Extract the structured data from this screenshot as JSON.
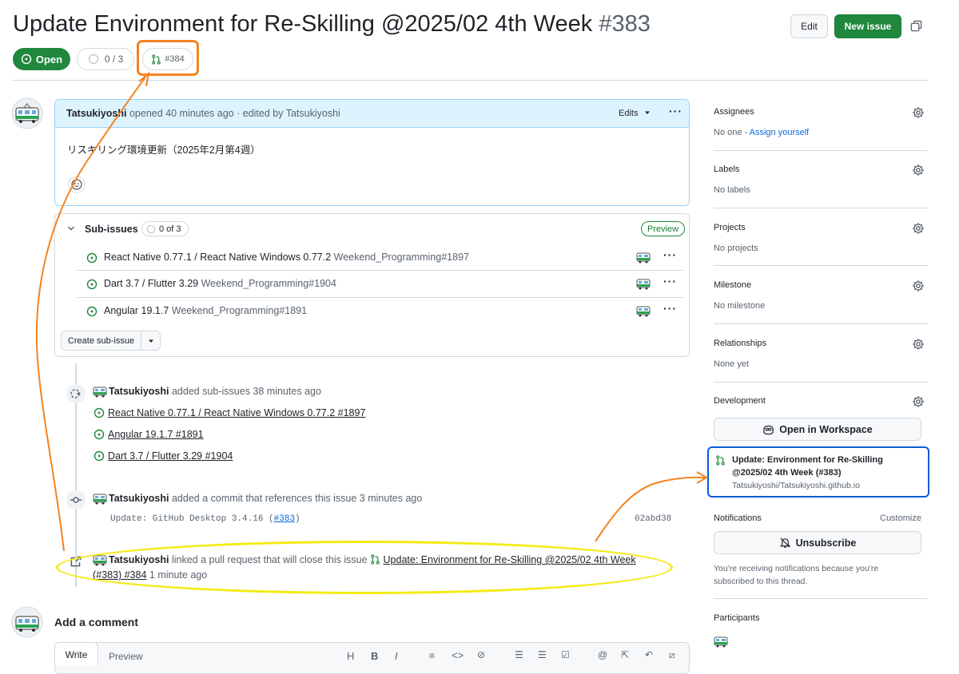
{
  "issue": {
    "title": "Update Environment for Re-Skilling @2025/02 4th Week",
    "number": "#383",
    "state": "Open",
    "subissue_progress": "0 / 3",
    "linked_pr": "#384"
  },
  "header_buttons": {
    "edit": "Edit",
    "new_issue": "New issue"
  },
  "description": {
    "author": "Tatsukiyoshi",
    "meta": "opened 40 minutes ago · edited by Tatsukiyoshi",
    "edits_label": "Edits",
    "body": "リスキリング環境更新（2025年2月第4週）"
  },
  "subissues": {
    "title": "Sub-issues",
    "progress": "0 of 3",
    "preview_badge": "Preview",
    "items": [
      {
        "title": "React Native 0.77.1 / React Native Windows 0.77.2",
        "ref": "Weekend_Programming#1897"
      },
      {
        "title": "Dart 3.7 / Flutter 3.29",
        "ref": "Weekend_Programming#1904"
      },
      {
        "title": "Angular 19.1.7",
        "ref": "Weekend_Programming#1891"
      }
    ],
    "create_button": "Create sub-issue"
  },
  "timeline": {
    "event1": {
      "author": "Tatsukiyoshi",
      "text": "added sub-issues 38 minutes ago",
      "links": [
        "React Native 0.77.1 / React Native Windows 0.77.2 #1897",
        "Angular 19.1.7 #1891",
        "Dart 3.7 / Flutter 3.29 #1904"
      ]
    },
    "event2": {
      "author": "Tatsukiyoshi",
      "text": "added a commit that references this issue 3 minutes ago",
      "commit_msg": "Update: GitHub Desktop 3.4.16 (",
      "commit_ref": "#383",
      "commit_close": ")",
      "sha": "02abd38"
    },
    "event3": {
      "author": "Tatsukiyoshi",
      "text": "linked a pull request that will close this issue",
      "pr_title_line1": "Update: Environment for Re-Skilling @2025/02 4th Week",
      "pr_title_line2": "(#383) #384",
      "time": "1 minute ago"
    }
  },
  "comment": {
    "title": "Add a comment",
    "tabs": [
      "Write",
      "Preview"
    ],
    "toolbar": [
      "H",
      "B",
      "I"
    ]
  },
  "sidebar": {
    "assignees": {
      "label": "Assignees",
      "value_prefix": "No one - ",
      "value_link": "Assign yourself"
    },
    "labels": {
      "label": "Labels",
      "value": "No labels"
    },
    "projects": {
      "label": "Projects",
      "value": "No projects"
    },
    "milestone": {
      "label": "Milestone",
      "value": "No milestone"
    },
    "relationships": {
      "label": "Relationships",
      "value": "None yet"
    },
    "development": {
      "label": "Development",
      "workspace_button": "Open in Workspace",
      "pr_title": "Update: Environment for Re-Skilling @2025/02 4th Week (#383)",
      "pr_repo": "Tatsukiyoshi/Tatsukiyoshi.github.io"
    },
    "notifications": {
      "label": "Notifications",
      "customize": "Customize",
      "unsubscribe": "Unsubscribe",
      "note": "You're receiving notifications because you're subscribed to this thread."
    },
    "participants": {
      "label": "Participants"
    }
  },
  "colors": {
    "open_green": "#1f883d",
    "annotation_orange": "#f58220",
    "annotation_yellow": "#f5ea14",
    "highlight_blue": "#0b5cd5"
  },
  "icons": [
    "issue-opened-icon",
    "pull-request-icon",
    "gear-icon",
    "kebab-icon",
    "chevron-down-icon",
    "smiley-icon",
    "commit-icon",
    "bell-slash-icon",
    "copilot-icon",
    "copy-icon",
    "link-icon",
    "sub-issue-icon"
  ]
}
